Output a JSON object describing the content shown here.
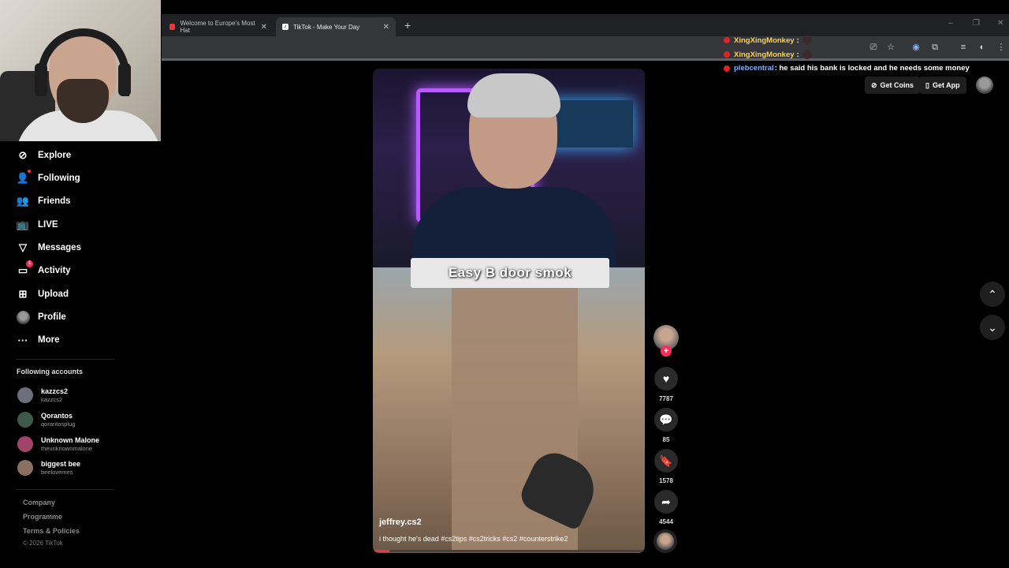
{
  "browser": {
    "tabs": [
      {
        "title": "Welcome to Europe's Most Hat",
        "active": false
      },
      {
        "title": "TikTok - Make Your Day",
        "active": true
      }
    ],
    "new_tab": "+",
    "controls": {
      "minimize": "–",
      "restore": "❐",
      "close": "✕"
    }
  },
  "sidebar": {
    "nav": [
      {
        "label": "Explore",
        "icon": "compass-icon"
      },
      {
        "label": "Following",
        "icon": "following-icon"
      },
      {
        "label": "Friends",
        "icon": "friends-icon"
      },
      {
        "label": "LIVE",
        "icon": "live-icon"
      },
      {
        "label": "Messages",
        "icon": "messages-icon"
      },
      {
        "label": "Activity",
        "icon": "activity-icon",
        "badge": "1"
      },
      {
        "label": "Upload",
        "icon": "upload-icon"
      },
      {
        "label": "Profile",
        "icon": "profile-icon"
      },
      {
        "label": "More",
        "icon": "more-icon"
      }
    ],
    "following_title": "Following accounts",
    "accounts": [
      {
        "name": "kazzcs2",
        "handle": "kazzcs2",
        "color": "#6b6f7a"
      },
      {
        "name": "Qorantos",
        "handle": "qorantosplug",
        "color": "#3e5a4a"
      },
      {
        "name": "Unknown Malone",
        "handle": "theunknownmalone",
        "color": "#a0446a"
      },
      {
        "name": "biggest bee",
        "handle": "beelovemes",
        "color": "#8a7060"
      }
    ],
    "footer": [
      "Company",
      "Programme",
      "Terms & Policies"
    ],
    "copyright": "© 2026 TikTok"
  },
  "video": {
    "overlay_text": "Easy B door smok",
    "author": "jeffrey.cs2",
    "description": "i thought he's dead #cs2tips #cs2tricks #cs2 #counterstrike2",
    "progress": 0.06
  },
  "actions": {
    "follow": "+",
    "likes": "7787",
    "comments": "85",
    "saves": "1578",
    "shares": "4544"
  },
  "chat": [
    {
      "user": "XingXingMonkey",
      "message": ":",
      "color": "#ffd24a"
    },
    {
      "user": "XingXingMonkey",
      "message": ":",
      "color": "#ffd24a"
    },
    {
      "user": "plebcentral",
      "message": ": he said his bank is locked and he needs some money",
      "color": "#7fb2ff"
    }
  ],
  "header": {
    "get_coins": "Get Coins",
    "get_app": "Get App"
  },
  "colors": {
    "accent": "#fe2c55",
    "background": "#000000",
    "chrome": "#202124"
  }
}
